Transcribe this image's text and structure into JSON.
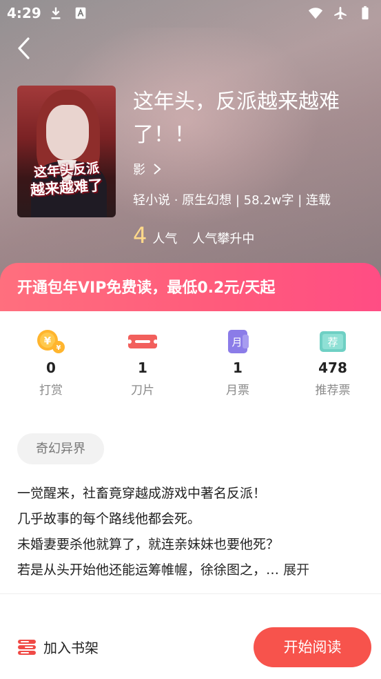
{
  "status_bar": {
    "time": "4:29"
  },
  "book": {
    "cover_title_line1": "这年头反派",
    "cover_title_line2": "越来越难了",
    "title": "这年头，反派越来越难了！！",
    "author": "影",
    "meta": "轻小说 · 原生幻想 | 58.2w字 | 连载",
    "popularity_value": "4",
    "popularity_label": "人气",
    "popularity_status": "人气攀升中"
  },
  "vip_banner": {
    "text": "开通包年VIP免费读，最低0.2元/天起"
  },
  "stats": [
    {
      "icon": "coin-icon",
      "value": "0",
      "label": "打赏"
    },
    {
      "icon": "blade-icon",
      "value": "1",
      "label": "刀片"
    },
    {
      "icon": "monthly-ticket-icon",
      "value": "1",
      "label": "月票"
    },
    {
      "icon": "recommend-ticket-icon",
      "value": "478",
      "label": "推荐票"
    }
  ],
  "tag": "奇幻异界",
  "description": {
    "lines": [
      "一觉醒来，社畜竟穿越成游戏中著名反派！",
      "几乎故事的每个路线他都会死。",
      "未婚妻要杀他就算了，就连亲妹妹也要他死？",
      "若是从头开始他还能运筹帷幄，徐徐图之，…"
    ],
    "expand": "展开"
  },
  "bottom_bar": {
    "add_shelf": "加入书架",
    "start_reading": "开始阅读"
  },
  "icon_glyphs": {
    "monthly_ticket": "月",
    "recommend_ticket": "荐"
  },
  "colors": {
    "accent_red": "#f7534c",
    "vip_gradient_start": "#ff6f7e",
    "vip_gradient_end": "#ff4d84",
    "popularity_number": "#ffd98a"
  }
}
